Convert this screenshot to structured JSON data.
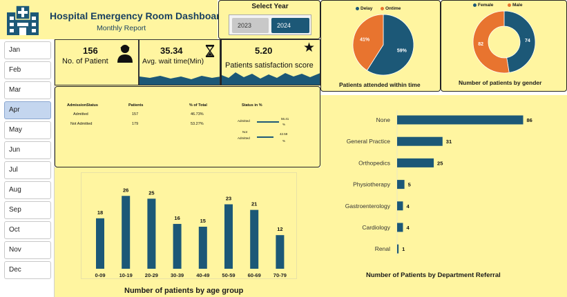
{
  "header": {
    "title": "Hospital Emergency Room Dashboard",
    "subtitle": "Monthly Report"
  },
  "year_selector": {
    "label": "Select Year",
    "options": [
      "2023",
      "2024"
    ],
    "selected": "2024"
  },
  "months": [
    "Jan",
    "Feb",
    "Mar",
    "Apr",
    "May",
    "Jun",
    "Jul",
    "Aug",
    "Sep",
    "Oct",
    "Nov",
    "Dec"
  ],
  "selected_month": "Apr",
  "kpis": {
    "patients": {
      "value": "156",
      "label": "No. of Patient",
      "icon": "patient-icon"
    },
    "wait": {
      "value": "35.34",
      "label": "Avg. wait time(Min)",
      "icon": "hourglass-icon"
    },
    "satisfaction": {
      "value": "5.20",
      "label": "Patients satisfaction score",
      "icon": "star-icon"
    }
  },
  "admission": {
    "headers": [
      "AdmissionStatus",
      "Patients",
      "% of Total",
      "Status in %"
    ],
    "rows": [
      {
        "status": "Admitted",
        "patients": "157",
        "pct": "46.73%"
      },
      {
        "status": "Not Admitted",
        "patients": "179",
        "pct": "53.27%"
      }
    ],
    "mini_labels": {
      "admitted": "Admitted",
      "not": "Not",
      "not2": "Admitted"
    },
    "mini_values": {
      "admitted_a": "56.41",
      "admitted_b": "%",
      "not_a": "42.59",
      "not_b": "%"
    }
  },
  "colors": {
    "primary": "#1c5877",
    "secondary": "#e8742f",
    "panel": "#fff5a0"
  },
  "chart_data": [
    {
      "type": "bar",
      "title": "Number of patients by age group",
      "categories": [
        "0-09",
        "10-19",
        "20-29",
        "30-39",
        "40-49",
        "50-59",
        "60-69",
        "70-79"
      ],
      "values": [
        18,
        26,
        25,
        16,
        15,
        23,
        21,
        12
      ],
      "ylim": [
        0,
        30
      ]
    },
    {
      "type": "pie",
      "title": "Patients attended within time",
      "legend": [
        "Delay",
        "Ontime"
      ],
      "values": [
        59,
        41
      ],
      "value_labels": [
        "59%",
        "41%"
      ],
      "colors": [
        "#1c5877",
        "#e8742f"
      ]
    },
    {
      "type": "pie",
      "title": "Number of patients by gender",
      "legend": [
        "Female",
        "Male"
      ],
      "values": [
        74,
        82
      ],
      "value_labels": [
        "74",
        "82"
      ],
      "colors": [
        "#1c5877",
        "#e8742f"
      ]
    },
    {
      "type": "bar",
      "title": "Number of Patients by Department Referral",
      "categories": [
        "None",
        "General Practice",
        "Orthopedics",
        "Physiotherapy",
        "Gastroenterology",
        "Cardiology",
        "Renal"
      ],
      "values": [
        86,
        31,
        25,
        5,
        4,
        4,
        1
      ],
      "xlim": [
        0,
        90
      ]
    }
  ]
}
